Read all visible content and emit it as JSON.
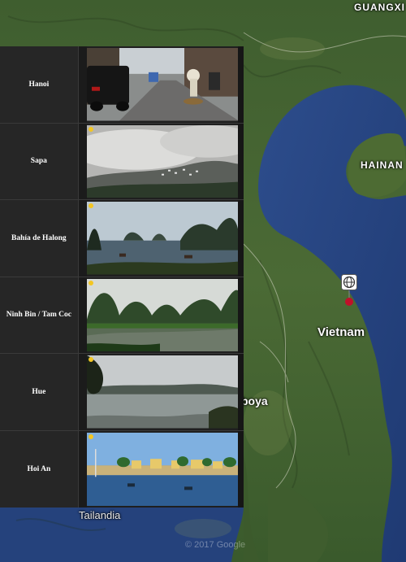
{
  "map": {
    "labels": {
      "guangxi": "GUANGXI",
      "hainan": "HAINAN",
      "vietnam": "Vietnam",
      "boya": "boya",
      "tailandia": "Tailandia",
      "copyright": "© 2017 Google"
    },
    "marker_icon": "globe-pin-icon"
  },
  "destinations": [
    {
      "label": "Hanoi",
      "scene": "street"
    },
    {
      "label": "Sapa",
      "scene": "mist-valley"
    },
    {
      "label": "Bahía de Halong",
      "scene": "bay-karst"
    },
    {
      "label": "Ninh Bin / Tam Coc",
      "scene": "river-karst"
    },
    {
      "label": "Hue",
      "scene": "river-hills"
    },
    {
      "label": "Hoi An",
      "scene": "harbor"
    }
  ],
  "colors": {
    "sea": "#2b4a86",
    "land_forest": "#3d5a2e",
    "panel_bg": "#1f1f1f",
    "marker": "#c0102a"
  }
}
